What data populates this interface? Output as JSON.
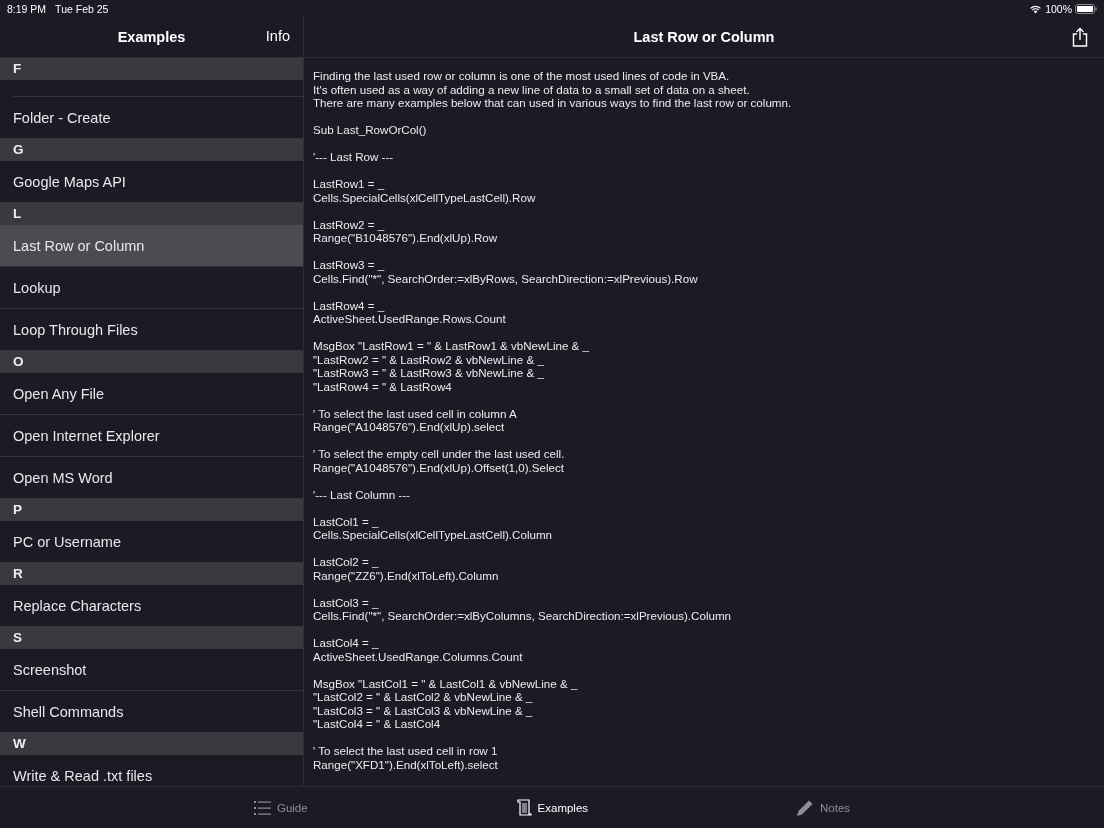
{
  "status_bar": {
    "time": "8:19 PM",
    "date": "Tue Feb 25",
    "battery": "100%"
  },
  "sidebar": {
    "title": "Examples",
    "info_button": "Info",
    "sections": [
      {
        "letter": "F",
        "items": [
          {
            "label": "Folder - Create",
            "selected": false
          }
        ]
      },
      {
        "letter": "G",
        "items": [
          {
            "label": "Google Maps API",
            "selected": false
          }
        ]
      },
      {
        "letter": "L",
        "items": [
          {
            "label": "Last Row or Column",
            "selected": true
          },
          {
            "label": "Lookup",
            "selected": false
          },
          {
            "label": "Loop Through Files",
            "selected": false
          }
        ]
      },
      {
        "letter": "O",
        "items": [
          {
            "label": "Open Any File",
            "selected": false
          },
          {
            "label": "Open Internet Explorer",
            "selected": false
          },
          {
            "label": "Open MS Word",
            "selected": false
          }
        ]
      },
      {
        "letter": "P",
        "items": [
          {
            "label": "PC or Username",
            "selected": false
          }
        ]
      },
      {
        "letter": "R",
        "items": [
          {
            "label": "Replace Characters",
            "selected": false
          }
        ]
      },
      {
        "letter": "S",
        "items": [
          {
            "label": "Screenshot",
            "selected": false
          },
          {
            "label": "Shell Commands",
            "selected": false
          }
        ]
      },
      {
        "letter": "W",
        "items": [
          {
            "label": "Write & Read .txt files",
            "selected": false
          }
        ]
      }
    ]
  },
  "detail": {
    "title": "Last Row or Column",
    "blocks": [
      {
        "lines": [
          "Finding the last used row or column is one of the most used lines of code in VBA.",
          "It's often used as a way of adding a new line of data to a small set of data on a sheet.",
          "There are many examples below that can used in various ways to find the last row or column."
        ]
      },
      {
        "lines": [
          "Sub Last_RowOrCol()"
        ]
      },
      {
        "lines": [
          "'--- Last Row ---"
        ]
      },
      {
        "lines": [
          "LastRow1 = _",
          "Cells.SpecialCells(xlCellTypeLastCell).Row"
        ]
      },
      {
        "lines": [
          "LastRow2 = _",
          "Range(\"B1048576\").End(xlUp).Row"
        ]
      },
      {
        "lines": [
          "LastRow3 = _",
          "Cells.Find(\"*\", SearchOrder:=xlByRows, SearchDirection:=xlPrevious).Row"
        ]
      },
      {
        "lines": [
          "LastRow4 = _",
          "ActiveSheet.UsedRange.Rows.Count"
        ]
      },
      {
        "lines": [
          "MsgBox \"LastRow1 = \" & LastRow1 & vbNewLine & _",
          "\"LastRow2 = \" & LastRow2 & vbNewLine & _",
          "\"LastRow3 = \" & LastRow3 & vbNewLine & _",
          "\"LastRow4 = \" & LastRow4"
        ]
      },
      {
        "lines": [
          "' To select the last used cell in column A",
          "Range(\"A1048576\").End(xlUp).select"
        ]
      },
      {
        "lines": [
          "' To select the empty cell under the last used cell.",
          "Range(\"A1048576\").End(xlUp).Offset(1,0).Select"
        ]
      },
      {
        "lines": [
          "'--- Last Column ---"
        ]
      },
      {
        "lines": [
          "LastCol1 = _",
          "Cells.SpecialCells(xlCellTypeLastCell).Column"
        ]
      },
      {
        "lines": [
          "LastCol2 = _",
          "Range(\"ZZ6\").End(xlToLeft).Column"
        ]
      },
      {
        "lines": [
          "LastCol3 = _",
          "Cells.Find(\"*\", SearchOrder:=xlByColumns, SearchDirection:=xlPrevious).Column"
        ]
      },
      {
        "lines": [
          "LastCol4 = _",
          "ActiveSheet.UsedRange.Columns.Count"
        ]
      },
      {
        "lines": [
          "MsgBox \"LastCol1 = \" & LastCol1 & vbNewLine & _",
          "\"LastCol2 = \" & LastCol2 & vbNewLine & _",
          "\"LastCol3 = \" & LastCol3 & vbNewLine & _",
          "\"LastCol4 = \" & LastCol4"
        ]
      },
      {
        "lines": [
          "' To select the last used cell in row 1",
          "Range(\"XFD1\").End(xlToLeft).select"
        ]
      }
    ]
  },
  "tab_bar": [
    {
      "kind": "list",
      "label": "Guide",
      "selected": false
    },
    {
      "kind": "scroll",
      "label": "Examples",
      "selected": true
    },
    {
      "kind": "pencil",
      "label": "Notes",
      "selected": false
    }
  ]
}
